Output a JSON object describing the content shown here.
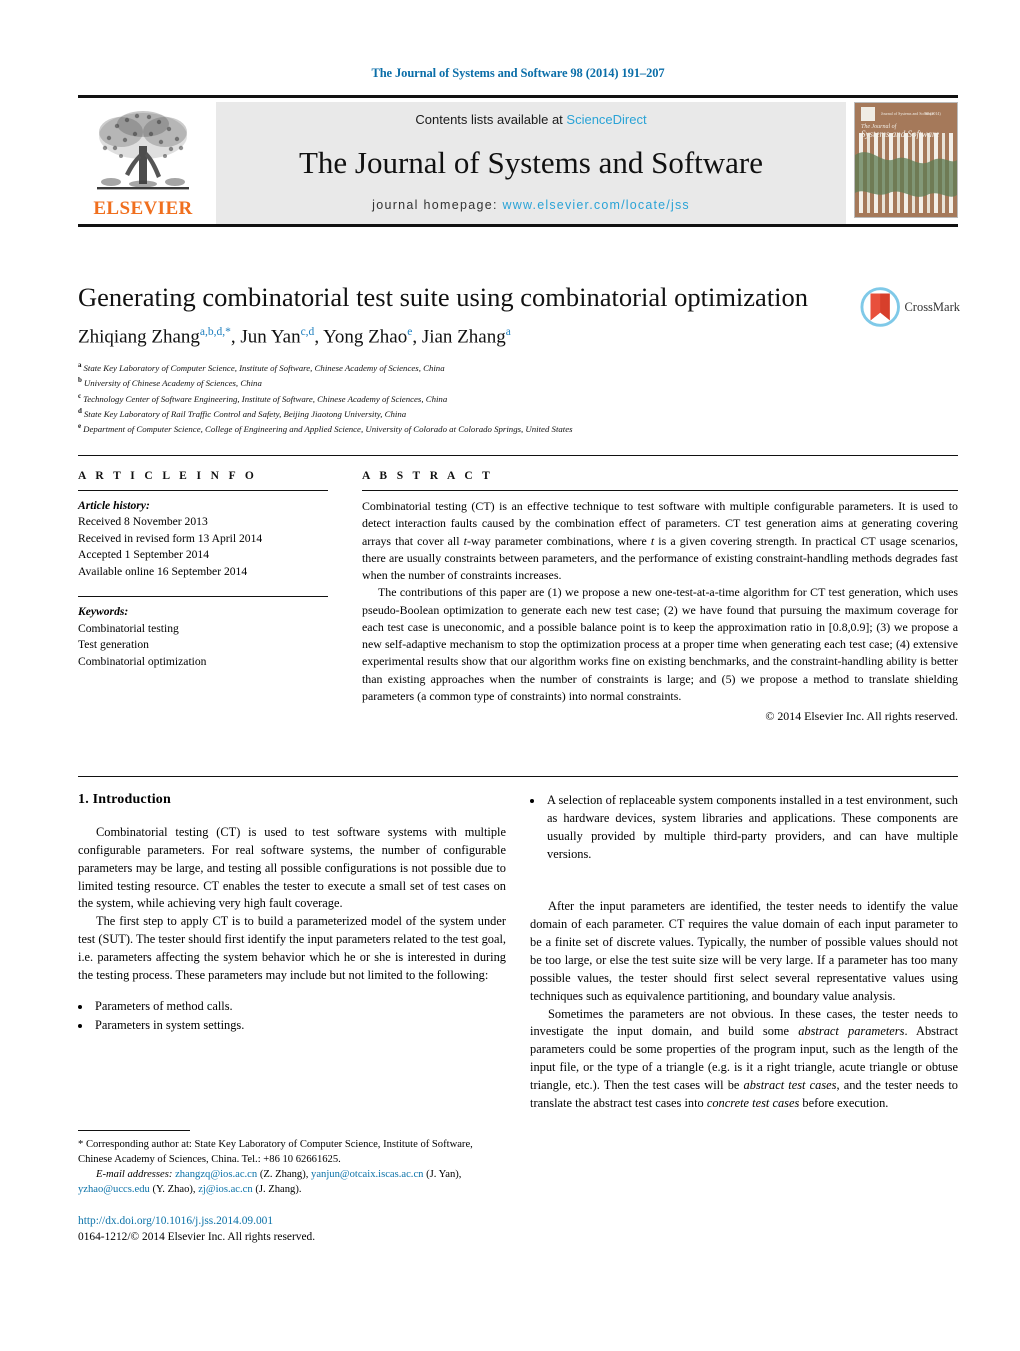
{
  "running_head": "The Journal of Systems and Software 98 (2014) 191–207",
  "masthead": {
    "publisher_name": "ELSEVIER",
    "contents_prefix": "Contents lists available at ",
    "contents_link": "ScienceDirect",
    "journal_title": "The Journal of Systems and Software",
    "homepage_prefix": "journal homepage: ",
    "homepage_url": "www.elsevier.com/locate/jss",
    "cover_title_line1": "The Journal of",
    "cover_title_line2": "Systems and Software"
  },
  "article": {
    "title": "Generating combinatorial test suite using combinatorial optimization",
    "crossmark_label": "CrossMark",
    "authors_html": "Zhiqiang Zhang<sup>a,b,d,</sup><sup>*</sup>, Jun Yan<sup>c,d</sup>, Yong Zhao<sup>e</sup>, Jian Zhang<sup>a</sup>",
    "affiliations": [
      {
        "label": "a",
        "text": "State Key Laboratory of Computer Science, Institute of Software, Chinese Academy of Sciences, China"
      },
      {
        "label": "b",
        "text": "University of Chinese Academy of Sciences, China"
      },
      {
        "label": "c",
        "text": "Technology Center of Software Engineering, Institute of Software, Chinese Academy of Sciences, China"
      },
      {
        "label": "d",
        "text": "State Key Laboratory of Rail Traffic Control and Safety, Beijing Jiaotong University, China"
      },
      {
        "label": "e",
        "text": "Department of Computer Science, College of Engineering and Applied Science, University of Colorado at Colorado Springs, United States"
      }
    ]
  },
  "article_info": {
    "heading": "A R T I C L E  I N F O",
    "history_label": "Article history:",
    "history": [
      "Received 8 November 2013",
      "Received in revised form 13 April 2014",
      "Accepted 1 September 2014",
      "Available online 16 September 2014"
    ],
    "keywords_label": "Keywords:",
    "keywords": [
      "Combinatorial testing",
      "Test generation",
      "Combinatorial optimization"
    ]
  },
  "abstract": {
    "heading": "A B S T R A C T",
    "paragraph1": "Combinatorial testing (CT) is an effective technique to test software with multiple configurable parameters. It is used to detect interaction faults caused by the combination effect of parameters. CT test generation aims at generating covering arrays that cover all t-way parameter combinations, where t is a given covering strength. In practical CT usage scenarios, there are usually constraints between parameters, and the performance of existing constraint-handling methods degrades fast when the number of constraints increases.",
    "paragraph2": "The contributions of this paper are (1) we propose a new one-test-at-a-time algorithm for CT test generation, which uses pseudo-Boolean optimization to generate each new test case; (2) we have found that pursuing the maximum coverage for each test case is uneconomic, and a possible balance point is to keep the approximation ratio in [0.8,0.9]; (3) we propose a new self-adaptive mechanism to stop the optimization process at a proper time when generating each test case; (4) extensive experimental results show that our algorithm works fine on existing benchmarks, and the constraint-handling ability is better than existing approaches when the number of constraints is large; and (5) we propose a method to translate shielding parameters (a common type of constraints) into normal constraints.",
    "copyright": "© 2014 Elsevier Inc. All rights reserved."
  },
  "body": {
    "section_number_title": "1.  Introduction",
    "left_p1": "Combinatorial testing (CT) is used to test software systems with multiple configurable parameters. For real software systems, the number of configurable parameters may be large, and testing all possible configurations is not possible due to limited testing resource. CT enables the tester to execute a small set of test cases on the system, while achieving very high fault coverage.",
    "left_p2": "The first step to apply CT is to build a parameterized model of the system under test (SUT). The tester should first identify the input parameters related to the test goal, i.e. parameters affecting the system behavior which he or she is interested in during the testing process. These parameters may include but not limited to the following:",
    "left_bullets": [
      "Parameters of method calls.",
      "Parameters in system settings."
    ],
    "right_bullets": [
      "A selection of replaceable system components installed in a test environment, such as hardware devices, system libraries and applications. These components are usually provided by multiple third-party providers, and can have multiple versions."
    ],
    "right_p1": "After the input parameters are identified, the tester needs to identify the value domain of each parameter. CT requires the value domain of each input parameter to be a finite set of discrete values. Typically, the number of possible values should not be too large, or else the test suite size will be very large. If a parameter has too many possible values, the tester should first select several representative values using techniques such as equivalence partitioning, and boundary value analysis.",
    "right_p2": "Sometimes the parameters are not obvious. In these cases, the tester needs to investigate the input domain, and build some abstract parameters. Abstract parameters could be some properties of the program input, such as the length of the input file, or the type of a triangle (e.g. is it a right triangle, acute triangle or obtuse triangle, etc.). Then the test cases will be abstract test cases, and the tester needs to translate the abstract test cases into concrete test cases before execution."
  },
  "footnote": {
    "corresponding": "* Corresponding author at: State Key Laboratory of Computer Science, Institute of Software, Chinese Academy of Sciences, China. Tel.: +86 10 62661625.",
    "email_label": "E-mail addresses:",
    "emails": [
      {
        "address": "zhangzq@ios.ac.cn",
        "owner": "(Z. Zhang)"
      },
      {
        "address": "yanjun@otcaix.iscas.ac.cn",
        "owner": "(J. Yan)"
      },
      {
        "address": "yzhao@uccs.edu",
        "owner": "(Y. Zhao)"
      },
      {
        "address": "zj@ios.ac.cn",
        "owner": "(J. Zhang)"
      }
    ]
  },
  "doi": {
    "url": "http://dx.doi.org/10.1016/j.jss.2014.09.001",
    "issn_line": "0164-1212/© 2014 Elsevier Inc. All rights reserved."
  },
  "colors": {
    "link_blue": "#0b72a8",
    "sciencedirect_blue": "#2aa3d6",
    "elsevier_orange": "#f06f1e",
    "superscript_blue": "#1f7fbf",
    "band_gray": "#e9e9e9"
  }
}
